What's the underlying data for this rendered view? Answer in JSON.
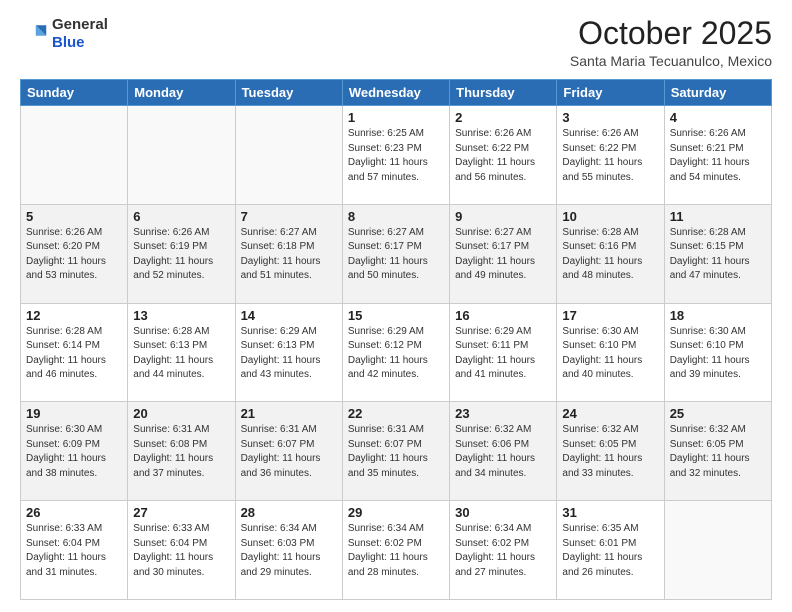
{
  "header": {
    "logo_general": "General",
    "logo_blue": "Blue",
    "month": "October 2025",
    "location": "Santa Maria Tecuanulco, Mexico"
  },
  "days_of_week": [
    "Sunday",
    "Monday",
    "Tuesday",
    "Wednesday",
    "Thursday",
    "Friday",
    "Saturday"
  ],
  "weeks": [
    [
      {
        "num": "",
        "info": ""
      },
      {
        "num": "",
        "info": ""
      },
      {
        "num": "",
        "info": ""
      },
      {
        "num": "1",
        "info": "Sunrise: 6:25 AM\nSunset: 6:23 PM\nDaylight: 11 hours\nand 57 minutes."
      },
      {
        "num": "2",
        "info": "Sunrise: 6:26 AM\nSunset: 6:22 PM\nDaylight: 11 hours\nand 56 minutes."
      },
      {
        "num": "3",
        "info": "Sunrise: 6:26 AM\nSunset: 6:22 PM\nDaylight: 11 hours\nand 55 minutes."
      },
      {
        "num": "4",
        "info": "Sunrise: 6:26 AM\nSunset: 6:21 PM\nDaylight: 11 hours\nand 54 minutes."
      }
    ],
    [
      {
        "num": "5",
        "info": "Sunrise: 6:26 AM\nSunset: 6:20 PM\nDaylight: 11 hours\nand 53 minutes."
      },
      {
        "num": "6",
        "info": "Sunrise: 6:26 AM\nSunset: 6:19 PM\nDaylight: 11 hours\nand 52 minutes."
      },
      {
        "num": "7",
        "info": "Sunrise: 6:27 AM\nSunset: 6:18 PM\nDaylight: 11 hours\nand 51 minutes."
      },
      {
        "num": "8",
        "info": "Sunrise: 6:27 AM\nSunset: 6:17 PM\nDaylight: 11 hours\nand 50 minutes."
      },
      {
        "num": "9",
        "info": "Sunrise: 6:27 AM\nSunset: 6:17 PM\nDaylight: 11 hours\nand 49 minutes."
      },
      {
        "num": "10",
        "info": "Sunrise: 6:28 AM\nSunset: 6:16 PM\nDaylight: 11 hours\nand 48 minutes."
      },
      {
        "num": "11",
        "info": "Sunrise: 6:28 AM\nSunset: 6:15 PM\nDaylight: 11 hours\nand 47 minutes."
      }
    ],
    [
      {
        "num": "12",
        "info": "Sunrise: 6:28 AM\nSunset: 6:14 PM\nDaylight: 11 hours\nand 46 minutes."
      },
      {
        "num": "13",
        "info": "Sunrise: 6:28 AM\nSunset: 6:13 PM\nDaylight: 11 hours\nand 44 minutes."
      },
      {
        "num": "14",
        "info": "Sunrise: 6:29 AM\nSunset: 6:13 PM\nDaylight: 11 hours\nand 43 minutes."
      },
      {
        "num": "15",
        "info": "Sunrise: 6:29 AM\nSunset: 6:12 PM\nDaylight: 11 hours\nand 42 minutes."
      },
      {
        "num": "16",
        "info": "Sunrise: 6:29 AM\nSunset: 6:11 PM\nDaylight: 11 hours\nand 41 minutes."
      },
      {
        "num": "17",
        "info": "Sunrise: 6:30 AM\nSunset: 6:10 PM\nDaylight: 11 hours\nand 40 minutes."
      },
      {
        "num": "18",
        "info": "Sunrise: 6:30 AM\nSunset: 6:10 PM\nDaylight: 11 hours\nand 39 minutes."
      }
    ],
    [
      {
        "num": "19",
        "info": "Sunrise: 6:30 AM\nSunset: 6:09 PM\nDaylight: 11 hours\nand 38 minutes."
      },
      {
        "num": "20",
        "info": "Sunrise: 6:31 AM\nSunset: 6:08 PM\nDaylight: 11 hours\nand 37 minutes."
      },
      {
        "num": "21",
        "info": "Sunrise: 6:31 AM\nSunset: 6:07 PM\nDaylight: 11 hours\nand 36 minutes."
      },
      {
        "num": "22",
        "info": "Sunrise: 6:31 AM\nSunset: 6:07 PM\nDaylight: 11 hours\nand 35 minutes."
      },
      {
        "num": "23",
        "info": "Sunrise: 6:32 AM\nSunset: 6:06 PM\nDaylight: 11 hours\nand 34 minutes."
      },
      {
        "num": "24",
        "info": "Sunrise: 6:32 AM\nSunset: 6:05 PM\nDaylight: 11 hours\nand 33 minutes."
      },
      {
        "num": "25",
        "info": "Sunrise: 6:32 AM\nSunset: 6:05 PM\nDaylight: 11 hours\nand 32 minutes."
      }
    ],
    [
      {
        "num": "26",
        "info": "Sunrise: 6:33 AM\nSunset: 6:04 PM\nDaylight: 11 hours\nand 31 minutes."
      },
      {
        "num": "27",
        "info": "Sunrise: 6:33 AM\nSunset: 6:04 PM\nDaylight: 11 hours\nand 30 minutes."
      },
      {
        "num": "28",
        "info": "Sunrise: 6:34 AM\nSunset: 6:03 PM\nDaylight: 11 hours\nand 29 minutes."
      },
      {
        "num": "29",
        "info": "Sunrise: 6:34 AM\nSunset: 6:02 PM\nDaylight: 11 hours\nand 28 minutes."
      },
      {
        "num": "30",
        "info": "Sunrise: 6:34 AM\nSunset: 6:02 PM\nDaylight: 11 hours\nand 27 minutes."
      },
      {
        "num": "31",
        "info": "Sunrise: 6:35 AM\nSunset: 6:01 PM\nDaylight: 11 hours\nand 26 minutes."
      },
      {
        "num": "",
        "info": ""
      }
    ]
  ]
}
